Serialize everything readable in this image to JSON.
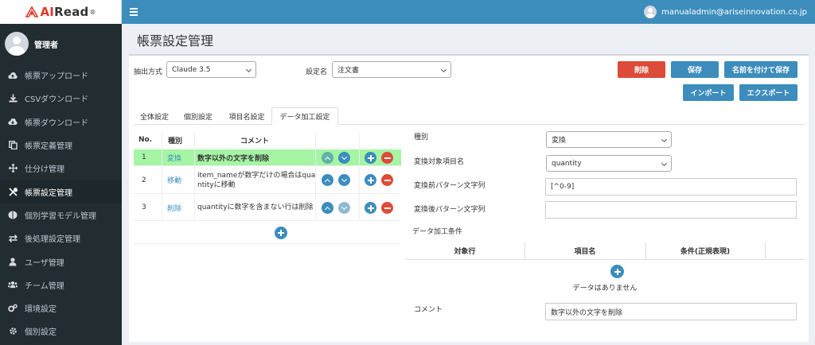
{
  "app": {
    "logo_ai": "AI",
    "logo_read": "Read",
    "logo_reg": "®"
  },
  "user": {
    "name": "管理者",
    "email": "manualadmin@ariseinnovation.co.jp"
  },
  "sidebar": {
    "items": [
      {
        "label": "帳票アップロード",
        "icon": "cloud-upload-icon"
      },
      {
        "label": "CSVダウンロード",
        "icon": "download-icon"
      },
      {
        "label": "帳票ダウンロード",
        "icon": "cloud-download-icon"
      },
      {
        "label": "帳票定義管理",
        "icon": "copy-icon"
      },
      {
        "label": "仕分け管理",
        "icon": "arrows-icon"
      },
      {
        "label": "帳票設定管理",
        "icon": "tools-icon",
        "active": true
      },
      {
        "label": "個別学習モデル管理",
        "icon": "brain-icon"
      },
      {
        "label": "後処理設定管理",
        "icon": "exchange-icon"
      },
      {
        "label": "ユーザ管理",
        "icon": "user-icon"
      },
      {
        "label": "チーム管理",
        "icon": "users-icon"
      },
      {
        "label": "環境設定",
        "icon": "cogs-icon"
      },
      {
        "label": "個別設定",
        "icon": "gear-icon"
      }
    ]
  },
  "page": {
    "title": "帳票設定管理"
  },
  "form": {
    "extract_label": "抽出方式",
    "extract_value": "Claude 3.5",
    "setting_label": "設定名",
    "setting_value": "注文書"
  },
  "buttons": {
    "delete": "削除",
    "save": "保存",
    "save_as": "名前を付けて保存",
    "import": "インポート",
    "export": "エクスポート"
  },
  "tabs": [
    "全体設定",
    "個別設定",
    "項目名設定",
    "データ加工設定"
  ],
  "rules_table": {
    "headers": {
      "no": "No.",
      "kind": "種別",
      "comment": "コメント"
    },
    "rows": [
      {
        "no": "1",
        "kind": "変換",
        "comment": "数字以外の文字を削除",
        "selected": true
      },
      {
        "no": "2",
        "kind": "移動",
        "comment": "item_nameが数字だけの場合はquantityに移動"
      },
      {
        "no": "3",
        "kind": "削除",
        "comment": "quantityに数字を含まない行は削除"
      }
    ]
  },
  "detail": {
    "kind_label": "種別",
    "kind_value": "変換",
    "target_label": "変換対象項目名",
    "target_value": "quantity",
    "before_label": "変換前パターン文字列",
    "before_value": "[^0-9]",
    "after_label": "変換後パターン文字列",
    "after_value": "",
    "conditions_label": "データ加工条件",
    "cond_headers": {
      "row": "対象行",
      "item": "項目名",
      "condition": "条件(正規表現)"
    },
    "no_data": "データはありません",
    "comment_label": "コメント",
    "comment_value": "数字以外の文字を削除"
  },
  "colors": {
    "accent": "#3c8dbc",
    "danger": "#dd4b39",
    "sidebar": "#222d32",
    "selected_row": "#a5f5a5"
  }
}
